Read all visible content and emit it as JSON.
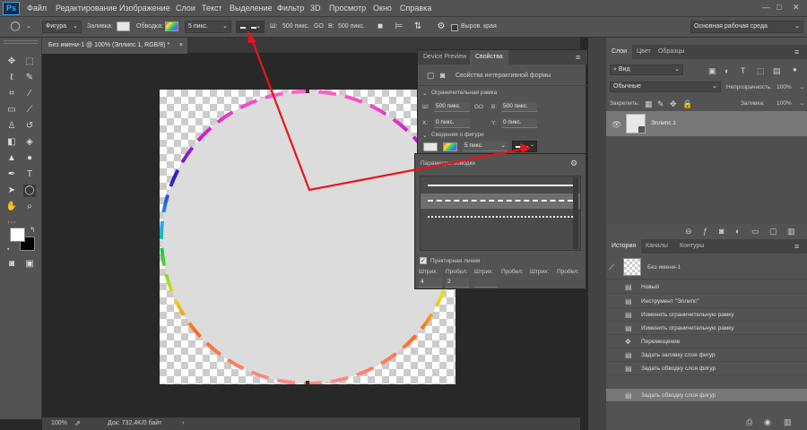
{
  "app": {
    "logo": "Ps"
  },
  "menu": [
    "Файл",
    "Редактирование",
    "Изображение",
    "Слои",
    "Текст",
    "Выделение",
    "Фильтр",
    "3D",
    "Просмотр",
    "Окно",
    "Справка"
  ],
  "window_controls": {
    "minimize": "—",
    "restore": "□",
    "close": "✕"
  },
  "options_bar": {
    "mode": "Фигура",
    "fill_label": "Заливка:",
    "stroke_label": "Обводка:",
    "stroke_width": "5 пикс.",
    "w_label": "Ш:",
    "w_value": "500 пикс.",
    "link_icon": "GO",
    "h_label": "В:",
    "h_value": "500 пикс.",
    "align_edges": "Выров. края",
    "workspace": "Основная рабочая среда"
  },
  "document": {
    "tab_title": "Без имени-1 @ 100% (Эллипс 1, RGB/8) *",
    "close": "×",
    "zoom": "100%",
    "doc_info": "Док: 732,4K/0 байт"
  },
  "properties": {
    "tabs": [
      "Device Preview",
      "Свойства"
    ],
    "active_tab": "Свойства",
    "header": "Свойства интерактивной формы",
    "bounding_box_section": "Ограничительная рамка",
    "w_label": "Ш:",
    "w_value": "500 пикс.",
    "link": "GO",
    "h_label": "В:",
    "h_value": "500 пикс.",
    "x_label": "X:",
    "x_value": "0 пикс.",
    "y_label": "Y:",
    "y_value": "0 пикс.",
    "shape_info_section": "Сведения о фигуре",
    "stroke_width": "5 пикс."
  },
  "stroke_options": {
    "title": "Параметры обводки",
    "dashed_checkbox_label": "Пунктирная линия",
    "dashed_checked": true,
    "columns": [
      "Штрих:",
      "Пробел:",
      "Штрих:",
      "Пробел:",
      "Штрих:",
      "Пробел:"
    ],
    "values": [
      "4",
      "2",
      "",
      "",
      "",
      ""
    ]
  },
  "layers_panel": {
    "tabs": [
      "Слои",
      "Цвет",
      "Образцы"
    ],
    "active_tab": "Слои",
    "filter": "Вид",
    "blend_mode": "Обычные",
    "opacity_label": "Непрозрачность:",
    "opacity_value": "100%",
    "lock_label": "Закрепить:",
    "fill_label": "Заливка:",
    "fill_value": "100%",
    "layers": [
      {
        "name": "Эллипс 1",
        "visible": true
      }
    ]
  },
  "history_panel": {
    "tabs": [
      "История",
      "Каналы",
      "Контуры"
    ],
    "active_tab": "История",
    "snapshot": "Без имени-1",
    "items": [
      "Новый",
      "Инструмент \"Эллипс\"",
      "Изменить ограничительную рамку",
      "Изменить ограничительную рамку",
      "Перемещение",
      "Задать заливку слоя фигур",
      "Задать обводку слоя фигур",
      "Задать обводку слоя фигур"
    ],
    "selected_index": 7
  },
  "colors": {
    "accent": "#31a8ff",
    "ellipse_fill": "#dcdcdc",
    "arrow": "#e8141b",
    "panel_bg": "#535353",
    "canvas_bg": "#282828"
  }
}
